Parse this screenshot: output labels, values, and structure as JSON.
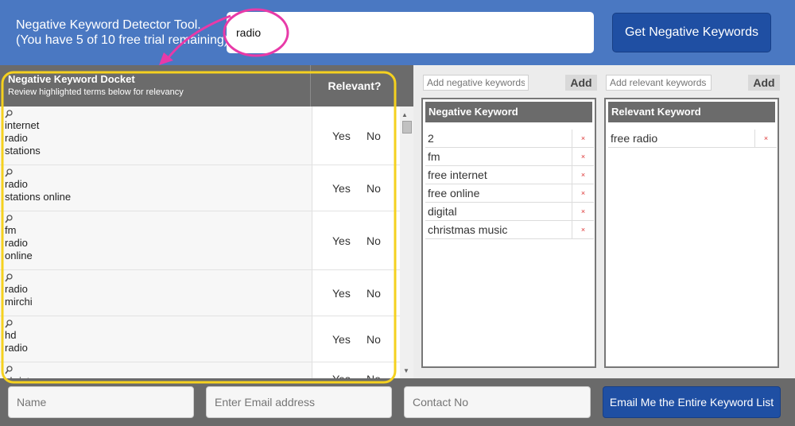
{
  "header": {
    "title_line1": "Negative Keyword Detector Tool.",
    "title_line2": "(You have 5 of 10 free trial remaining)",
    "search_value": "radio",
    "get_button": "Get Negative Keywords"
  },
  "docket": {
    "title": "Negative Keyword Docket",
    "subtitle": "Review highlighted terms below for relevancy",
    "relevant_label": "Relevant?",
    "yes_label": "Yes",
    "no_label": "No",
    "rows": [
      {
        "lines": [
          "internet",
          "radio",
          "stations"
        ]
      },
      {
        "lines": [
          "radio",
          "stations online"
        ]
      },
      {
        "lines": [
          "fm",
          "radio",
          "online"
        ]
      },
      {
        "lines": [
          "radio",
          "mirchi"
        ]
      },
      {
        "lines": [
          "hd",
          "radio"
        ]
      },
      {
        "lines": [
          "christmas"
        ]
      }
    ]
  },
  "negative_panel": {
    "input_placeholder": "Add negative keywords",
    "add_label": "Add",
    "header": "Negative Keyword",
    "items": [
      "2",
      "fm",
      "free internet",
      "free online",
      "digital",
      "christmas music"
    ],
    "remove_glyph": "×"
  },
  "relevant_panel": {
    "input_placeholder": "Add relevant keywords",
    "add_label": "Add",
    "header": "Relevant Keyword",
    "items": [
      "free radio"
    ],
    "remove_glyph": "×"
  },
  "footer": {
    "name_placeholder": "Name",
    "email_placeholder": "Enter Email address",
    "contact_placeholder": "Contact No",
    "email_button": "Email Me the Entire Keyword List"
  },
  "colors": {
    "header_blue": "#4a78c2",
    "button_blue": "#1f4fa3",
    "annotation_pink": "#e83aa8",
    "annotation_yellow": "#f5d11f"
  }
}
